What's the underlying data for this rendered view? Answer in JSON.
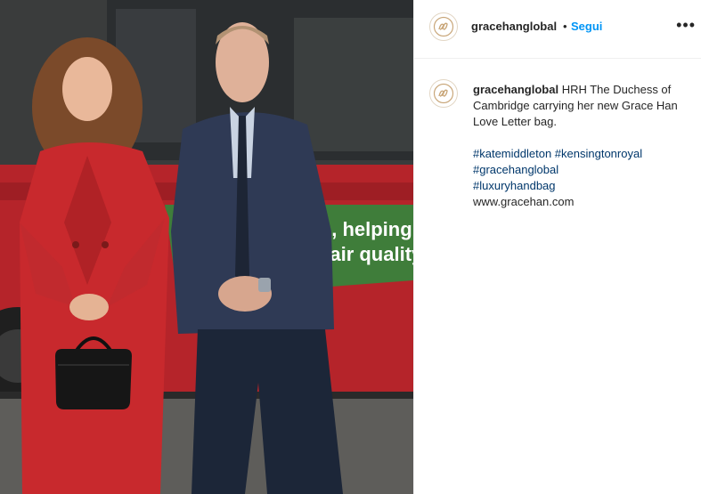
{
  "post": {
    "username": "gracehanglobal",
    "separator": "•",
    "follow_label": "Segui",
    "more_label": "•••"
  },
  "caption": {
    "username": "gracehanglobal",
    "text": " HRH The Duchess of Cambridge carrying her new Grace Han Love Letter bag.",
    "hashtags": [
      "#katemiddleton",
      "#kensingtonroyal",
      "#gracehanglobal",
      "#luxuryhandbag"
    ],
    "website": "www.gracehan.com"
  },
  "photo": {
    "bus_text_line1": "s, helping",
    "bus_text_line2": "e air quality"
  },
  "icons": {
    "avatar": "gracehan-logo-icon",
    "more": "more-options-icon"
  }
}
